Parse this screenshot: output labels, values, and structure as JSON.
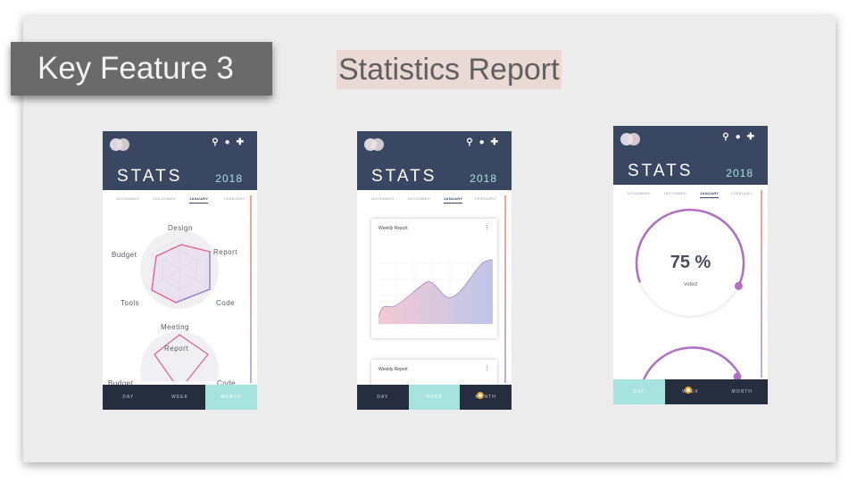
{
  "slide": {
    "feature_label": "Key Feature 3",
    "report_title": "Statistics Report"
  },
  "app": {
    "title": "STATS",
    "year": "2018",
    "months": [
      "NOVEMBER",
      "DECEMBER",
      "JANUARY",
      "FEBRUARY"
    ],
    "active_month": "JANUARY",
    "header_icons": [
      "search-icon",
      "notification-icon",
      "add-icon"
    ],
    "tabs": [
      "DAY",
      "WEEK",
      "MONTH"
    ]
  },
  "screens": {
    "radar": {
      "active_tab": "MONTH",
      "axis_labels": [
        "Design",
        "Report",
        "Code",
        "Meeting",
        "Tools",
        "Budget"
      ],
      "second_chart_labels": [
        "Report",
        "Budget",
        "Code"
      ]
    },
    "weekly": {
      "active_tab": "WEEK",
      "card_title": "Weekly Report",
      "card_menu": "⋮",
      "second_card_title": "Weekly Report"
    },
    "voted": {
      "active_tab": "DAY",
      "percent": "75 %",
      "caption": "voted",
      "progress": 0.75
    }
  },
  "colors": {
    "header": "#3a4763",
    "year": "#a9e1dc",
    "active_tab": "#a6e3de",
    "bottom_bar": "#252d3f",
    "accent_purple": "#b06ec4",
    "accent_pink": "#e45c8c"
  }
}
